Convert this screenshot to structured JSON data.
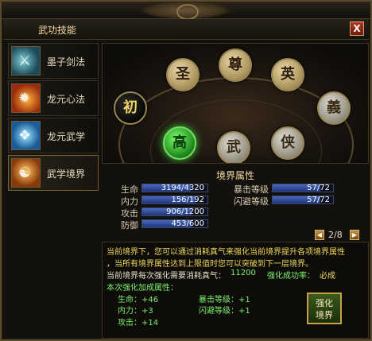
{
  "window": {
    "title": "武功技能",
    "close_label": "X"
  },
  "tabs": [
    {
      "label": "墨子剑法",
      "icon": "sword-icon"
    },
    {
      "label": "龙元心法",
      "icon": "fire-orb-icon"
    },
    {
      "label": "龙元武学",
      "icon": "blue-book-icon"
    },
    {
      "label": "武学境界",
      "icon": "meditating-monk-icon"
    }
  ],
  "realm_nodes": [
    "初",
    "圣",
    "尊",
    "英",
    "義",
    "高",
    "武",
    "侠"
  ],
  "attributes": {
    "title": "境界属性",
    "left": [
      {
        "label": "生命",
        "value": "3194/4320",
        "fraction": 0.739
      },
      {
        "label": "内力",
        "value": "156/192",
        "fraction": 0.8125
      },
      {
        "label": "攻击",
        "value": "906/1200",
        "fraction": 0.755
      },
      {
        "label": "防御",
        "value": "453/600",
        "fraction": 0.755
      }
    ],
    "right": [
      {
        "label": "暴击等级",
        "value": "57/72",
        "fraction": 0.79
      },
      {
        "label": "闪避等级",
        "value": "57/72",
        "fraction": 0.79
      }
    ]
  },
  "pager": {
    "text": "2/8",
    "prev": "◀",
    "next": "▶"
  },
  "info": {
    "line1": "当前境界下，您可以通过消耗真气来强化当前境界提升各项境界属性",
    "line2": "，当所有境界属性达到上限值时您可以突破到下一层境界。",
    "cost_label": "当前境界每次强化需要消耗真气：",
    "cost_value": "11200",
    "rate_label": "强化成功率：",
    "rate_value": "必成",
    "bonus_title": "本次强化加成属性：",
    "bonus": [
      {
        "label": "生命：+46"
      },
      {
        "label": "暴击等级：+1"
      },
      {
        "label": "内力：+3"
      },
      {
        "label": "闪避等级：+1"
      },
      {
        "label": "攻击：+14"
      }
    ]
  },
  "upgrade_button": {
    "line1": "强化",
    "line2": "境界"
  }
}
